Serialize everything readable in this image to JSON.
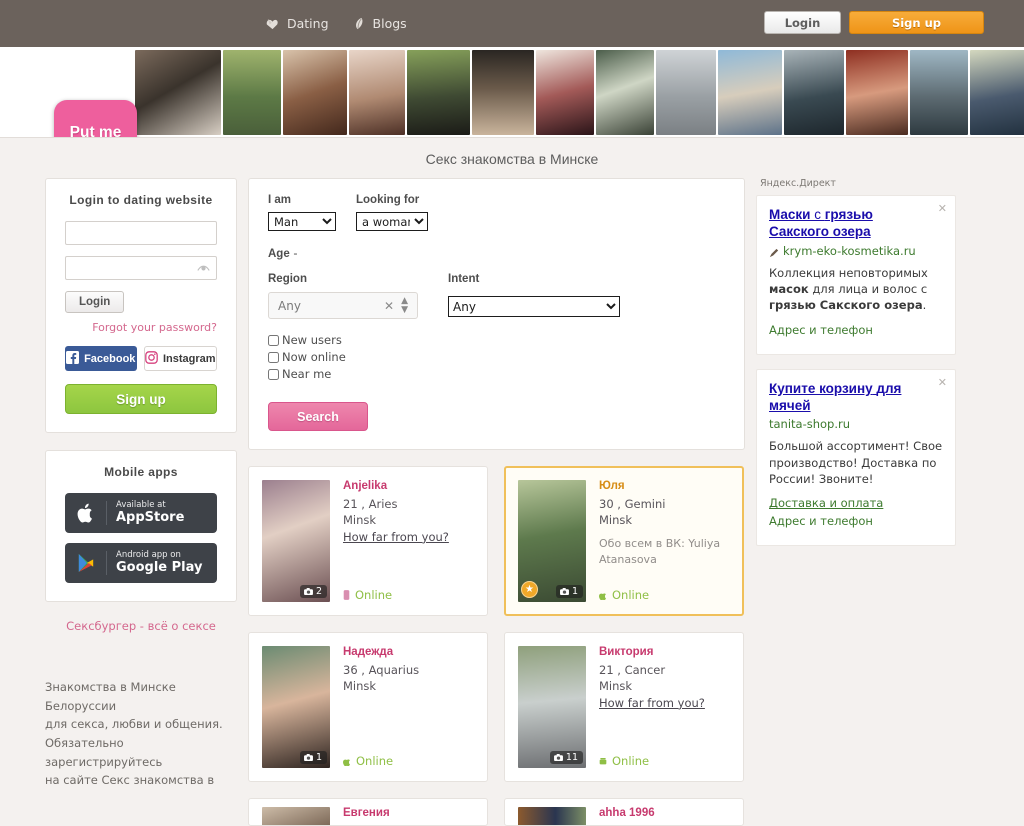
{
  "header": {
    "nav": [
      {
        "label": "Dating",
        "icon": "heart-ribbon-icon"
      },
      {
        "label": "Blogs",
        "icon": "pencil-icon"
      }
    ],
    "login_label": "Login",
    "signup_label": "Sign up"
  },
  "strip": {
    "put_me_here": "Put me here!"
  },
  "page_title": "Секс знакомства в Минске",
  "login_panel": {
    "title": "Login to dating website",
    "username_value": "",
    "username_placeholder": "",
    "password_value": "",
    "password_placeholder": "",
    "login_button": "Login",
    "forgot_link": "Forgot your password?",
    "facebook_label": "Facebook",
    "instagram_label": "Instagram",
    "signup_button": "Sign up"
  },
  "mobile_panel": {
    "title": "Mobile apps",
    "appstore_small": "Available at",
    "appstore_big": "AppStore",
    "google_small": "Android app on",
    "google_big": "Google Play"
  },
  "sidebar_promo": {
    "link": "Сексбургер - всё о сексе",
    "text": "Знакомства в Минске\nБелоруссии\nдля секса, любви и общения.\nОбязательно зарегистрируйтесь\nна сайте Секс знакомства в"
  },
  "search": {
    "i_am_label": "I am",
    "i_am_value": "Man",
    "looking_for_label": "Looking for",
    "looking_for_value": "a woman",
    "age_label": "Age",
    "age_value": "-",
    "region_label": "Region",
    "region_value": "Any",
    "intent_label": "Intent",
    "intent_value": "Any",
    "checkboxes": [
      {
        "label": "New users",
        "checked": false
      },
      {
        "label": "Now online",
        "checked": false
      },
      {
        "label": "Near me",
        "checked": false
      }
    ],
    "search_button": "Search"
  },
  "profiles": [
    {
      "name": "Anjelika",
      "age_sign": "21 , Aries",
      "city": "Minsk",
      "distance_link": "How far from you?",
      "note": "",
      "photos": "2",
      "status": "Online",
      "featured": false,
      "starred": false
    },
    {
      "name": "Юля",
      "age_sign": "30 , Gemini",
      "city": "Minsk",
      "distance_link": "",
      "note": "Обо всем в ВК: Yuliya Atanasova",
      "photos": "1",
      "status": "Online",
      "featured": true,
      "starred": true
    },
    {
      "name": "Надежда",
      "age_sign": "36 , Aquarius",
      "city": "Minsk",
      "distance_link": "",
      "note": "",
      "photos": "1",
      "status": "Online",
      "featured": false,
      "starred": false
    },
    {
      "name": "Виктория",
      "age_sign": "21 , Cancer",
      "city": "Minsk",
      "distance_link": "How far from you?",
      "note": "",
      "photos": "11",
      "status": "Online",
      "featured": false,
      "starred": false
    }
  ],
  "profiles_cut": [
    {
      "name": "Евгения"
    },
    {
      "name": "ahha 1996"
    }
  ],
  "ads": {
    "network_label": "Яндекс.Директ",
    "items": [
      {
        "title_a": "Маски",
        "title_b": " с ",
        "title_c": "грязью Сакского озера",
        "domain": "krym-eko-kosmetika.ru",
        "body_pre": "Коллекция неповторимых ",
        "body_b1": "масок",
        "body_mid": " для лица и волос с ",
        "body_b2": "грязью Сакского озера",
        "body_post": ".",
        "links": [
          "Адрес и телефон"
        ],
        "close": "✕"
      },
      {
        "title_a": "Купите корзину",
        "title_b": " ",
        "title_c": "для мячей",
        "domain": "tanita-shop.ru",
        "body_pre": "Большой ассортимент! Свое производство! Доставка по России! Звоните!",
        "body_b1": "",
        "body_mid": "",
        "body_b2": "",
        "body_post": "",
        "links": [
          "Доставка и оплата",
          "Адрес и телефон"
        ],
        "close": "✕"
      }
    ]
  },
  "colors": {
    "topbar": "#6b625c",
    "signup_orange": "#ef9417",
    "pink": "#ee5f9d",
    "green": "#8dc63f",
    "name_pink": "#c73a6e",
    "featured_border": "#f0c05a"
  }
}
